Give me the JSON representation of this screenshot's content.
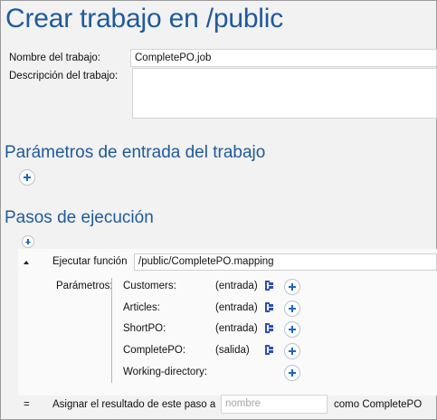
{
  "page": {
    "title": "Crear trabajo en /public"
  },
  "job": {
    "name_label": "Nombre del trabajo:",
    "name_value": "CompletePO.job",
    "description_label": "Descripción del trabajo:",
    "description_value": ""
  },
  "input_params": {
    "heading": "Parámetros de entrada del trabajo"
  },
  "steps": {
    "heading": "Pasos de ejecución",
    "execute_label": "Ejecutar función",
    "function_path": "/public/CompletePO.mapping",
    "params_label": "Parámetros:",
    "params": [
      {
        "name": "Customers:",
        "direction": "(entrada)",
        "has_icon": true
      },
      {
        "name": "Articles:",
        "direction": "(entrada)",
        "has_icon": true
      },
      {
        "name": "ShortPO:",
        "direction": "(entrada)",
        "has_icon": true
      },
      {
        "name": "CompletePO:",
        "direction": "(salida)",
        "has_icon": true
      },
      {
        "name": "Working-directory:",
        "direction": "",
        "has_icon": false
      }
    ],
    "assign_symbol": "=",
    "assign_label": "Asignar el resultado de este paso a",
    "assign_placeholder": "nombre",
    "assign_suffix": "como CompletePO"
  },
  "colors": {
    "heading": "#1f5a9c",
    "plus_icon": "#1e66b8",
    "map_icon": "#2b4fb3"
  }
}
